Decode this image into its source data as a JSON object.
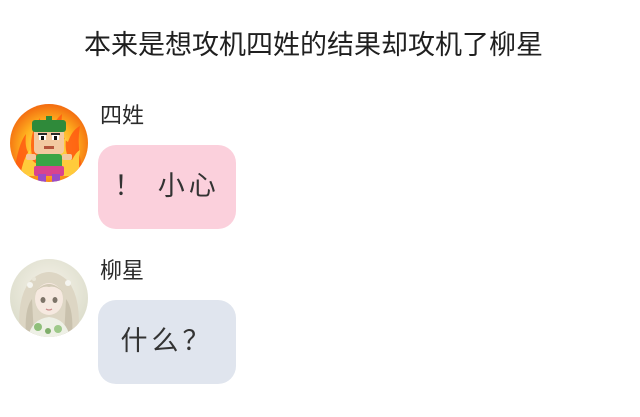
{
  "header": {
    "title": "本来是想攻机四姓的结果却攻机了柳星"
  },
  "messages": [
    {
      "sender": "四姓",
      "text": "！ 小心",
      "bubble_color": "#fbd0dc",
      "avatar_icon": "fire-character-avatar"
    },
    {
      "sender": "柳星",
      "text": "什么？",
      "bubble_color": "#e0e5ee",
      "avatar_icon": "anime-girl-avatar"
    }
  ]
}
